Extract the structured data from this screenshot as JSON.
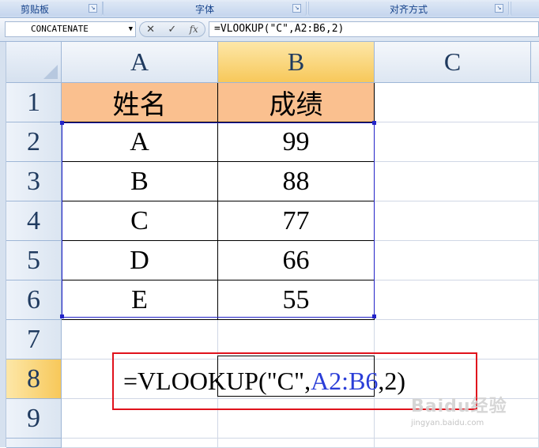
{
  "ribbon": {
    "groups": [
      {
        "label": "剪贴板"
      },
      {
        "label": "字体"
      },
      {
        "label": "对齐方式"
      }
    ]
  },
  "formula_bar": {
    "name_box": "CONCATENATE",
    "cancel_symbol": "✕",
    "enter_symbol": "✓",
    "fx_label": "fx",
    "formula": "=VLOOKUP(\"C\",A2:B6,2)"
  },
  "sheet": {
    "columns": [
      "A",
      "B",
      "C"
    ],
    "rows": [
      "1",
      "2",
      "3",
      "4",
      "5",
      "6",
      "7",
      "8",
      "9"
    ],
    "table": {
      "headers": [
        "姓名",
        "成绩"
      ],
      "data": [
        [
          "A",
          "99"
        ],
        [
          "B",
          "88"
        ],
        [
          "C",
          "77"
        ],
        [
          "D",
          "66"
        ],
        [
          "E",
          "55"
        ]
      ]
    },
    "edit_cell": {
      "prefix": "=VLOOKUP(\"C\",",
      "ref": "A2:B6",
      "suffix": ",2)"
    }
  },
  "watermark": {
    "main": "Baidu经验",
    "sub": "jingyan.baidu.com"
  },
  "colors": {
    "header_fill": "#fac08f",
    "selected_header": "#f7c85a",
    "range_border": "#2424c8",
    "highlight_box": "#e0121c"
  }
}
